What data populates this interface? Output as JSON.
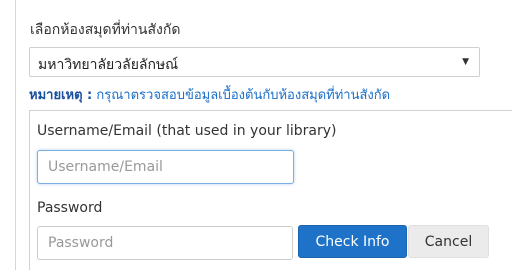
{
  "library": {
    "label": "เลือกห้องสมุดที่ท่านสังกัด",
    "selected": "มหาวิทยาลัยวลัยลักษณ์",
    "caret_icon": "caret-down-icon"
  },
  "note": {
    "title": "หมายเหตุ :",
    "text": "กรุณาตรวจสอบข้อมูลเบื้องต้นกับห้องสมุดที่ท่านสังกัด"
  },
  "form": {
    "username_label": "Username/Email (that used in your library)",
    "username_placeholder": "Username/Email",
    "password_label": "Password",
    "password_placeholder": "Password",
    "check_label": "Check Info",
    "cancel_label": "Cancel"
  },
  "colors": {
    "accent": "#1e72c8",
    "note_title": "#1a4fa0",
    "note_text": "#1a6fc8"
  }
}
